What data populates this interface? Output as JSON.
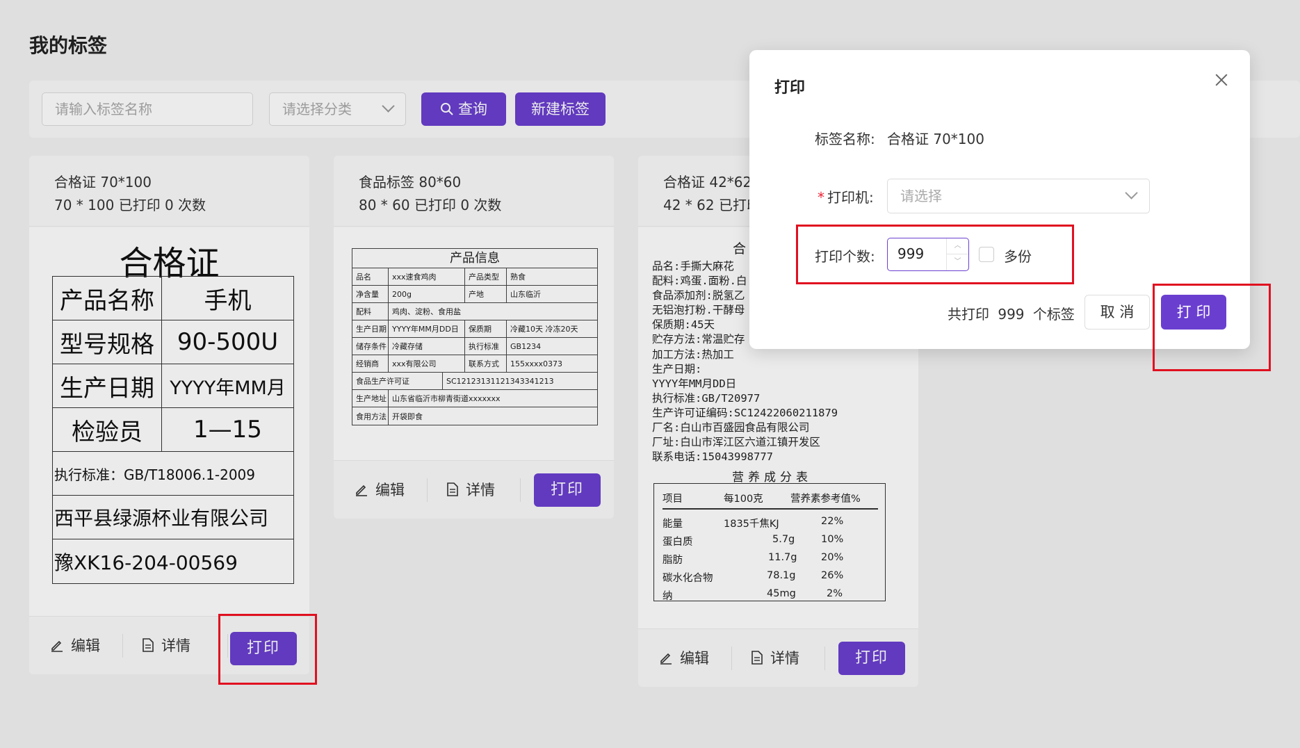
{
  "page": {
    "title": "我的标签"
  },
  "toolbar": {
    "search_placeholder": "请输入标签名称",
    "category_placeholder": "请选择分类",
    "query_label": "查询",
    "new_label": "新建标签"
  },
  "cards": [
    {
      "name": "合格证 70*100",
      "meta": "70 * 100   已打印 0 次数",
      "edit": "编辑",
      "detail": "详情",
      "print": "打印",
      "label": {
        "title": "合格证",
        "rows": [
          {
            "k": "产品名称",
            "v": "手机"
          },
          {
            "k": "型号规格",
            "v": "90-500U"
          },
          {
            "k": "生产日期",
            "v": "YYYY年MM月"
          },
          {
            "k": "检验员",
            "v": "1—15"
          }
        ],
        "standard": "执行标准：GB/T18006.1-2009",
        "company": "西平县绿源杯业有限公司",
        "license": "豫XK16-204-00569"
      }
    },
    {
      "name": "食品标签 80*60",
      "meta": "80 * 60   已打印 0 次数",
      "edit": "编辑",
      "detail": "详情",
      "print": "打印",
      "label": {
        "title": "产品信息",
        "r1": [
          "品名",
          "xxx速食鸡肉",
          "产品类型",
          "熟食"
        ],
        "r2": [
          "净含量",
          "200g",
          "产地",
          "山东临沂"
        ],
        "r3": [
          "配料",
          "鸡肉、淀粉、食用盐"
        ],
        "r4": [
          "生产日期",
          "YYYY年MM月DD日",
          "保质期",
          "冷藏10天 冷冻20天"
        ],
        "r5": [
          "储存条件",
          "冷藏存储",
          "执行标准",
          "GB1234"
        ],
        "r6": [
          "经销商",
          "xxx有限公司",
          "联系方式",
          "155xxxx0373"
        ],
        "r7": [
          "食品生产许可证",
          "SC12123131121343341213"
        ],
        "r8": [
          "生产地址",
          "山东省临沂市柳青街道xxxxxxx"
        ],
        "r9": [
          "食用方法",
          "开袋即食"
        ]
      }
    },
    {
      "name": "合格证 42*62",
      "meta": "42 * 62   已打印",
      "edit": "编辑",
      "detail": "详情",
      "print": "打印",
      "label": {
        "title": "合",
        "lines": [
          "品名:手撕大麻花",
          "配料:鸡蛋.面粉.白",
          "食品添加剂:脱氢乙",
          "无铝泡打粉.干酵母",
          "保质期:45天",
          "贮存方法:常温贮存",
          "加工方法:热加工",
          "生产日期:",
          "YYYY年MM月DD日",
          "执行标准:GB/T20977",
          "生产许可证编码:SC12422060211879",
          "厂名:白山市百盛园食品有限公司",
          "厂址:白山市浑江区六道江镇开发区",
          "联系电话:15043998777"
        ],
        "nutrition_title": "营养成分表",
        "nutrition_header": [
          "项目",
          "每100克",
          "营养素参考值%"
        ],
        "nutrition_rows": [
          [
            "能量",
            "1835千焦KJ",
            "22%"
          ],
          [
            "蛋白质",
            "5.7g",
            "10%"
          ],
          [
            "脂肪",
            "11.7g",
            "20%"
          ],
          [
            "碳水化合物",
            "78.1g",
            "26%"
          ],
          [
            "纳",
            "45mg",
            "2%"
          ]
        ]
      }
    }
  ],
  "modal": {
    "title": "打印",
    "name_label": "标签名称:",
    "name_value": "合格证 70*100",
    "printer_label": "打印机:",
    "printer_placeholder": "请选择",
    "count_label": "打印个数:",
    "count_value": "999",
    "multi_label": "多份",
    "summary_prefix": "共打印",
    "summary_count": "999",
    "summary_suffix": "个标签",
    "cancel": "取 消",
    "confirm": "打 印"
  },
  "colors": {
    "primary": "#6a3fd0",
    "highlight": "#e01020"
  }
}
